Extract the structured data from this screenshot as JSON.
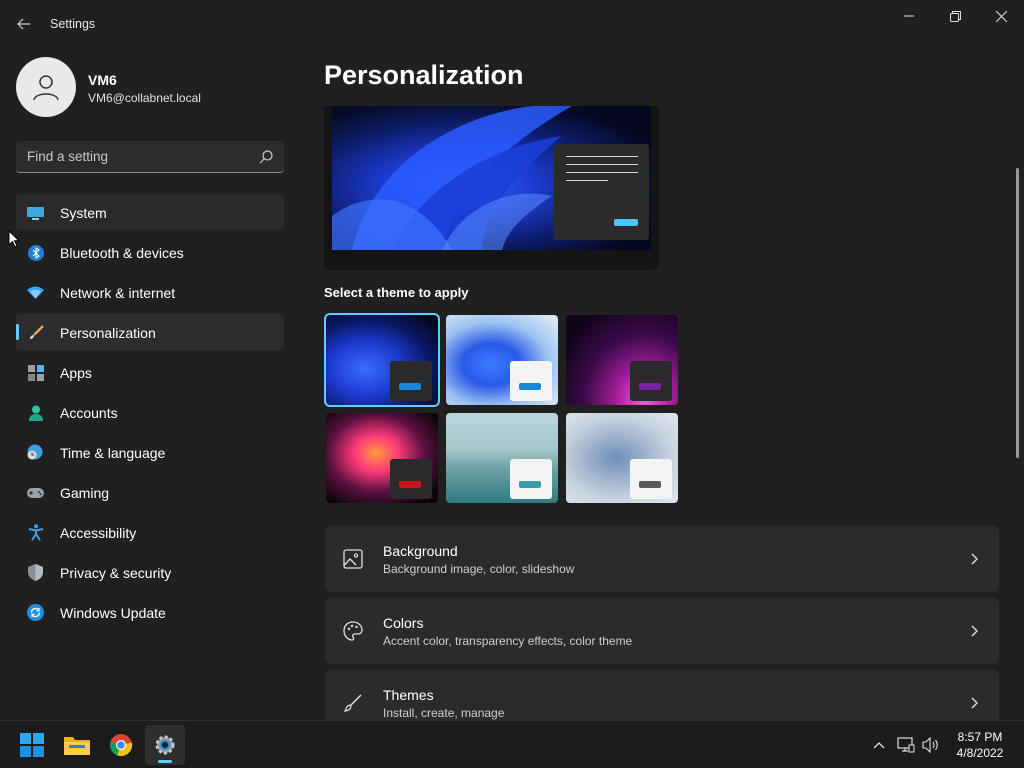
{
  "window": {
    "app_title": "Settings"
  },
  "user": {
    "name": "VM6",
    "email": "VM6@collabnet.local"
  },
  "search": {
    "placeholder": "Find a setting"
  },
  "sidebar": {
    "items": [
      {
        "label": "System",
        "icon": "monitor-icon",
        "state": "hover"
      },
      {
        "label": "Bluetooth & devices",
        "icon": "bluetooth-icon"
      },
      {
        "label": "Network & internet",
        "icon": "wifi-icon"
      },
      {
        "label": "Personalization",
        "icon": "brush-icon",
        "state": "selected"
      },
      {
        "label": "Apps",
        "icon": "apps-icon"
      },
      {
        "label": "Accounts",
        "icon": "person-icon"
      },
      {
        "label": "Time & language",
        "icon": "globe-clock-icon"
      },
      {
        "label": "Gaming",
        "icon": "gamepad-icon"
      },
      {
        "label": "Accessibility",
        "icon": "accessibility-icon"
      },
      {
        "label": "Privacy & security",
        "icon": "shield-icon"
      },
      {
        "label": "Windows Update",
        "icon": "update-icon"
      }
    ]
  },
  "main": {
    "title": "Personalization",
    "themes_label": "Select a theme to apply",
    "themes": [
      {
        "name": "windows-dark-bloom",
        "selected": true,
        "button_color": "#1a86d8"
      },
      {
        "name": "windows-light-bloom",
        "button_color": "#1a86d8"
      },
      {
        "name": "glow",
        "button_color": "#7a1fa8"
      },
      {
        "name": "captured-motion",
        "button_color": "#c8151c"
      },
      {
        "name": "flow",
        "button_color": "#3a9aa8"
      },
      {
        "name": "sunrise",
        "button_color": "#5a5a5a"
      }
    ],
    "cards": [
      {
        "title": "Background",
        "subtitle": "Background image, color, slideshow",
        "icon": "image-icon"
      },
      {
        "title": "Colors",
        "subtitle": "Accent color, transparency effects, color theme",
        "icon": "palette-icon"
      },
      {
        "title": "Themes",
        "subtitle": "Install, create, manage",
        "icon": "paintbrush-icon"
      }
    ]
  },
  "taskbar": {
    "apps": [
      "start-icon",
      "file-explorer-icon",
      "chrome-icon",
      "settings-icon"
    ],
    "clock": {
      "time": "8:57 PM",
      "date": "4/8/2022"
    }
  },
  "colors": {
    "accent": "#60cdff",
    "background": "#202020",
    "card": "#2b2b2b"
  }
}
